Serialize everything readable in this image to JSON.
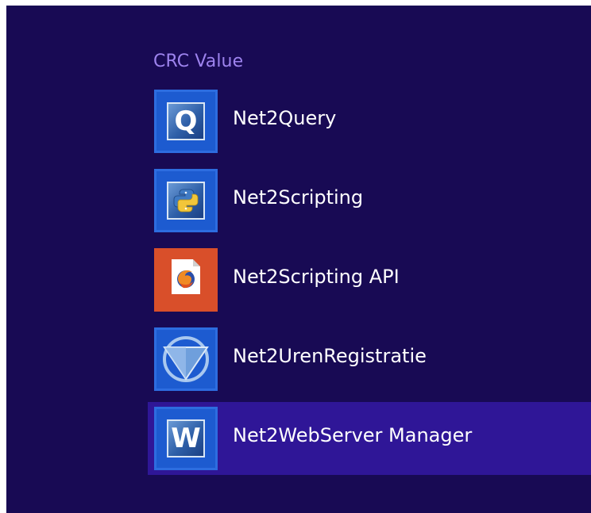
{
  "group": {
    "title": "CRC Value"
  },
  "apps": [
    {
      "label": "Net2Query",
      "icon": "query-q-icon"
    },
    {
      "label": "Net2Scripting",
      "icon": "python-icon"
    },
    {
      "label": "Net2Scripting API",
      "icon": "firefox-document-icon"
    },
    {
      "label": "Net2UrenRegistratie",
      "icon": "triangle-circle-icon"
    },
    {
      "label": "Net2WebServer Manager",
      "icon": "word-w-icon",
      "selected": true
    }
  ],
  "colors": {
    "background": "#180a54",
    "group_title": "#9d83ee",
    "selection": "#2f1697",
    "tile_blue": "#1d5bd0",
    "tile_orange": "#d94f2a"
  }
}
